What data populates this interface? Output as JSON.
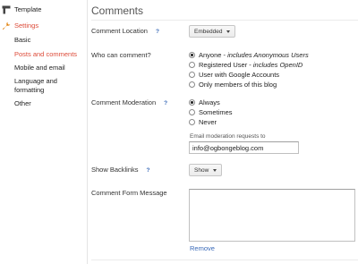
{
  "sidebar": {
    "template_label": "Template",
    "settings_label": "Settings",
    "items": [
      {
        "label": "Basic"
      },
      {
        "label": "Posts and comments"
      },
      {
        "label": "Mobile and email"
      },
      {
        "label": "Language and formatting"
      },
      {
        "label": "Other"
      }
    ],
    "icons": {
      "template": "template-icon",
      "settings": "wrench-icon"
    },
    "accent_color": "#dd4b39"
  },
  "main": {
    "title": "Comments",
    "comment_location": {
      "label": "Comment Location",
      "help": "?",
      "value": "Embedded"
    },
    "who_can_comment": {
      "label": "Who can comment?",
      "options": [
        {
          "text": "Anyone",
          "note": "includes Anonymous Users",
          "checked": true
        },
        {
          "text": "Registered User",
          "note": "includes OpenID",
          "checked": false
        },
        {
          "text": "User with Google Accounts",
          "note": "",
          "checked": false
        },
        {
          "text": "Only members of this blog",
          "note": "",
          "checked": false
        }
      ]
    },
    "comment_moderation": {
      "label": "Comment Moderation",
      "help": "?",
      "options": [
        {
          "text": "Always",
          "checked": true
        },
        {
          "text": "Sometimes",
          "checked": false
        },
        {
          "text": "Never",
          "checked": false
        }
      ],
      "email_caption": "Email moderation requests to",
      "email_value": "info@ogbongeblog.com"
    },
    "show_backlinks": {
      "label": "Show Backlinks",
      "help": "?",
      "value": "Show"
    },
    "comment_form_message": {
      "label": "Comment Form Message",
      "value": "",
      "remove_label": "Remove"
    },
    "link_color": "#3a6ab8"
  }
}
